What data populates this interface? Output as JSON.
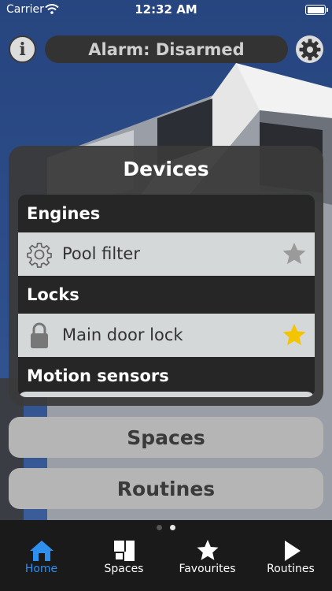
{
  "status_bar": {
    "carrier": "Carrier",
    "time": "12:32 AM"
  },
  "header": {
    "info_glyph": "i",
    "alarm_status": "Alarm: Disarmed"
  },
  "devices": {
    "title": "Devices",
    "sections": [
      {
        "header": "Engines",
        "device": {
          "label": "Pool filter",
          "icon": "gear-icon",
          "favourite": false
        }
      },
      {
        "header": "Locks",
        "device": {
          "label": "Main door lock",
          "icon": "lock-icon",
          "favourite": true
        }
      },
      {
        "header": "Motion sensors"
      }
    ]
  },
  "buttons": {
    "spaces": "Spaces",
    "routines": "Routines"
  },
  "page_indicator": {
    "pages": 2,
    "current": 2
  },
  "tab_bar": {
    "tabs": [
      {
        "label": "Home",
        "icon": "home-icon",
        "active": true
      },
      {
        "label": "Spaces",
        "icon": "spaces-icon",
        "active": false
      },
      {
        "label": "Favourites",
        "icon": "star-icon",
        "active": false
      },
      {
        "label": "Routines",
        "icon": "play-icon",
        "active": false
      }
    ]
  },
  "colors": {
    "accent": "#2f8fef",
    "favourite_star": "#f5c400",
    "inactive_star": "#9a9a9a"
  }
}
